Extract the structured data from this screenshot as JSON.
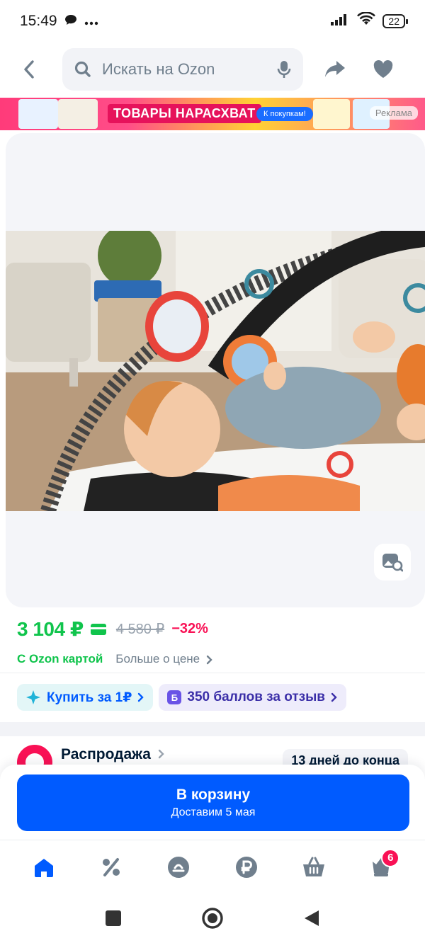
{
  "status_bar": {
    "time": "15:49",
    "battery": "22"
  },
  "header": {
    "search_placeholder": "Искать на Ozon"
  },
  "promo": {
    "title": "ТОВАРЫ НАРАСХВАТ",
    "button": "К покупкам!",
    "ad_label": "Реклама"
  },
  "product": {
    "price": "3 104 ₽",
    "old_price": "4 580 ₽",
    "discount": "−32%",
    "ozon_card_label": "С Ozon картой",
    "more_about_price": "Больше о цене"
  },
  "chips": {
    "buy_for_one": "Купить за 1₽",
    "bonus_badge": "Б",
    "bonus": "350 баллов за отзыв"
  },
  "sale": {
    "title": "Распродажа",
    "days_left": "13 дней до конца"
  },
  "cart": {
    "title": "В корзину",
    "delivery": "Доставим 5 мая"
  },
  "bottom_nav": {
    "cart_badge": "6",
    "accent": "#005bff",
    "inactive": "#707f8d"
  },
  "colors": {
    "brand": "#005bff",
    "price_green": "#10c44c",
    "discount_red": "#f91155"
  }
}
